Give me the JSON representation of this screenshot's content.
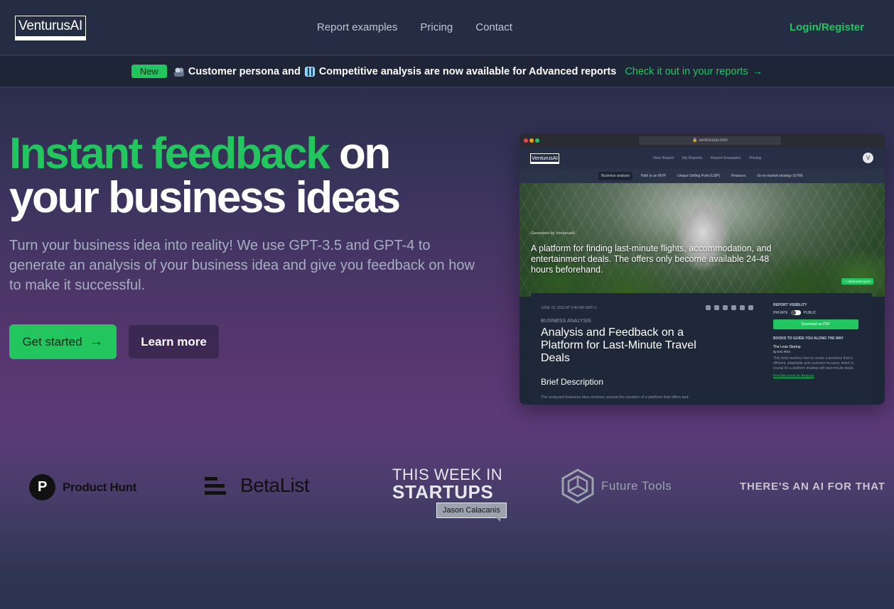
{
  "nav": {
    "logo": "VenturusAI",
    "links": [
      "Report examples",
      "Pricing",
      "Contact"
    ],
    "login": "Login/Register"
  },
  "banner": {
    "badge": "New",
    "text_part1": "Customer persona and",
    "text_part2": "Competitive analysis are now available for Advanced reports",
    "cta": "Check it out in your reports",
    "cta_arrow": "→"
  },
  "hero": {
    "headline_green": "Instant feedback",
    "headline_white1": " on",
    "headline_white2": "your business ideas",
    "subtitle": "Turn your business idea into reality! We use GPT-3.5 and GPT-4 to generate an analysis of your business idea and give you feedback on how to make it successful.",
    "primary_button": "Get started",
    "primary_arrow": "→",
    "secondary_button": "Learn more"
  },
  "mock": {
    "url": "🔒 venturusai.com",
    "logo": "VenturusAI",
    "nav_links": [
      "New Report",
      "My Reports",
      "Report Examples",
      "Pricing"
    ],
    "avatar": "V",
    "tabs": [
      "Business analysis",
      "Path to an MVP",
      "Unique Selling Point (USP)",
      "Finances",
      "Go-to-market strategy (GTM)"
    ],
    "generated_by": "Generated by VenturusAI",
    "headline": "A platform for finding last-minute flights, accommodation, and entertainment deals. The offers only become available 24-48 hours beforehand.",
    "advanced_badge": "+ Advanced report",
    "date": "JUNE 19, 2023 AT 9:40 AM GMT+1",
    "category": "BUSINESS ANALYSIS",
    "title": "Analysis and Feedback on a Platform for Last-Minute Travel Deals",
    "brief_heading": "Brief Description",
    "brief_text": "The analyzed business idea revolves around the creation of a platform that offers last-",
    "visibility_label": "REPORT VISIBILITY",
    "private": "PRIVATE",
    "public": "PUBLIC",
    "download": "Download as PDF",
    "books_heading": "BOOKS TO GUIDE YOU ALONG THE WAY",
    "book_title": "The Lean Startup",
    "book_author": "by Eric Ries",
    "book_desc": "This book teaches how to create a business that is efficient, adaptable and customer-focused, which is crucial for a platform dealing with last-minute deals.",
    "book_link": "Find this book on Amazon"
  },
  "logos": {
    "product_hunt": "Product Hunt",
    "product_hunt_letter": "P",
    "betalist": "BetaList",
    "twis_line1": "THIS WEEK IN",
    "twis_line2": "STARTUPS",
    "twis_tag": "Jason Calacanis",
    "future_tools": "Future Tools",
    "taaift": "THERE'S AN AI FOR THAT"
  },
  "colors": {
    "accent": "#22c55e",
    "nav_bg": "#242d44"
  }
}
